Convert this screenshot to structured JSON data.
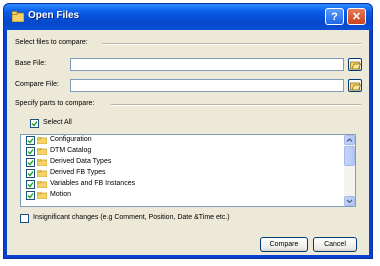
{
  "window": {
    "title": "Open Files",
    "help_label": "?",
    "close_label": "✕"
  },
  "section_select": {
    "label": "Select files to compare:"
  },
  "base_file": {
    "label": "Base File:",
    "value": ""
  },
  "compare_file": {
    "label": "Compare File:",
    "value": ""
  },
  "section_parts": {
    "label": "Specify parts to compare:"
  },
  "select_all": {
    "label": "Select All",
    "checked": true
  },
  "parts": [
    {
      "label": "Configuration",
      "checked": true
    },
    {
      "label": "DTM Catalog",
      "checked": true
    },
    {
      "label": "Derived Data Types",
      "checked": true
    },
    {
      "label": "Derived FB Types",
      "checked": true
    },
    {
      "label": "Variables and FB Instances",
      "checked": true
    },
    {
      "label": "Motion",
      "checked": true
    }
  ],
  "insignificant": {
    "label": "Insignificant changes (e.g Comment, Position, Date &Time etc.)",
    "checked": false
  },
  "buttons": {
    "compare": "Compare",
    "cancel": "Cancel"
  },
  "colors": {
    "title_bar": "#0a5ce8",
    "dialog_bg": "#ece9d8",
    "close_button": "#c8441c",
    "folder": "#f5d36a"
  }
}
